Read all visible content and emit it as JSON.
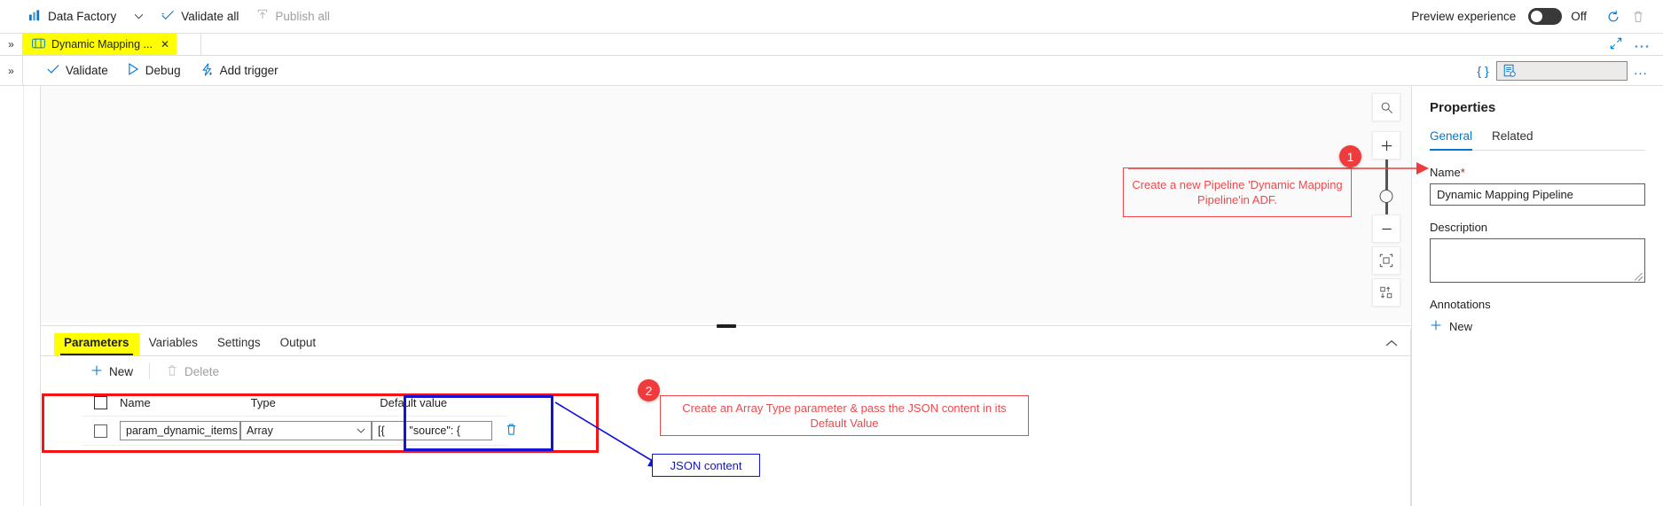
{
  "topbar": {
    "service_name": "Data Factory",
    "service_chevron": "⌄",
    "validate_all": "Validate all",
    "publish_all": "Publish all",
    "preview_experience_label": "Preview experience",
    "toggle_state": "Off",
    "refresh_icon": "refresh-icon",
    "delete_icon": "trash-icon"
  },
  "tabstrip": {
    "rail_expand": "»",
    "tab_label": "Dynamic Mapping ...",
    "tab_close": "✕",
    "expand_icon": "expand-diagonal-icon",
    "more_icon": "ellipsis-icon"
  },
  "actionbar": {
    "rail_expand": "»",
    "validate": "Validate",
    "debug": "Debug",
    "add_trigger": "Add trigger",
    "code_icon": "{ }",
    "json_view_icon": "json-document-icon",
    "more_icon": "..."
  },
  "canvas": {
    "zoom_search_icon": "magnifier-icon",
    "zoom_in": "+",
    "zoom_out": "—",
    "fit_icon": "fit-to-screen-icon",
    "autolayout_icon": "auto-layout-icon"
  },
  "panel": {
    "tabs": [
      {
        "label": "Parameters",
        "active": true
      },
      {
        "label": "Variables",
        "active": false
      },
      {
        "label": "Settings",
        "active": false
      },
      {
        "label": "Output",
        "active": false
      }
    ],
    "collapse_icon": "chevron-up-icon",
    "new_label": "New",
    "delete_label": "Delete",
    "grid": {
      "headers": [
        "Name",
        "Type",
        "Default value"
      ],
      "rows": [
        {
          "name": "param_dynamic_items",
          "type": "Array",
          "default_value": "[{        \"source\": {",
          "delete_icon": "trash-icon"
        }
      ]
    }
  },
  "properties": {
    "title": "Properties",
    "tabs": [
      {
        "label": "General",
        "active": true
      },
      {
        "label": "Related",
        "active": false
      }
    ],
    "name_label": "Name",
    "name_required": "*",
    "name_value": "Dynamic Mapping Pipeline",
    "description_label": "Description",
    "description_value": "",
    "annotations_label": "Annotations",
    "annotation_new": "New"
  },
  "annotations": {
    "callout_1": {
      "number": "1",
      "text": "Create a new Pipeline 'Dynamic Mapping Pipeline'in ADF."
    },
    "callout_2": {
      "number": "2",
      "text": "Create an Array Type parameter & pass the JSON content in its Default Value"
    },
    "json_content_box": "JSON content"
  },
  "colors": {
    "accent": "#0078d4",
    "annotation_red": "#f1484b",
    "highlight_red": "#f81212",
    "highlight_blue": "#1414d2",
    "highlight_yellow": "#ffff00"
  }
}
